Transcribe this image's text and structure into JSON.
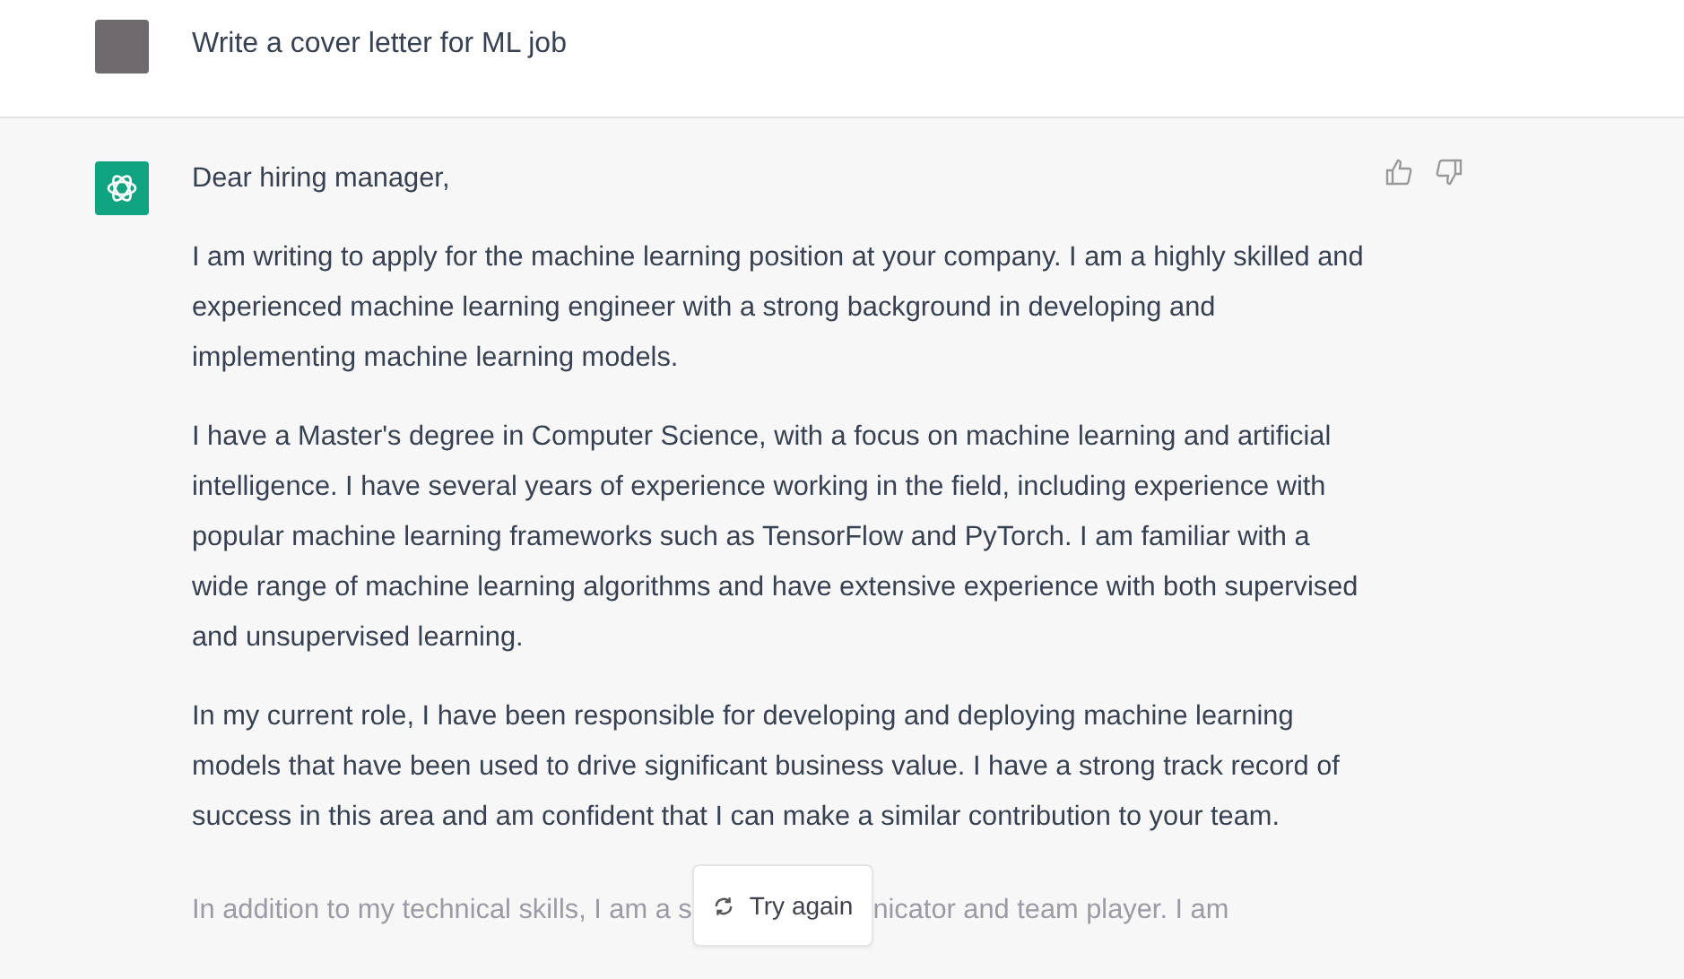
{
  "user_message": {
    "text": "Write a cover letter for ML job"
  },
  "assistant_message": {
    "paragraphs": [
      "Dear hiring manager,",
      "I am writing to apply for the machine learning position at your company. I am a highly skilled and experienced machine learning engineer with a strong background in developing and implementing machine learning models.",
      "I have a Master's degree in Computer Science, with a focus on machine learning and artificial intelligence. I have several years of experience working in the field, including experience with popular machine learning frameworks such as TensorFlow and PyTorch. I am familiar with a wide range of machine learning algorithms and have extensive experience with both supervised and unsupervised learning.",
      "In my current role, I have been responsible for developing and deploying machine learning models that have been used to drive significant business value. I have a strong track record of success in this area and am confident that I can make a similar contribution to your team."
    ],
    "faded_line": {
      "before": "In addition to my technical skills, I am a s",
      "after": "nicator and team player. I am"
    }
  },
  "try_again_button": {
    "label": "Try again"
  }
}
